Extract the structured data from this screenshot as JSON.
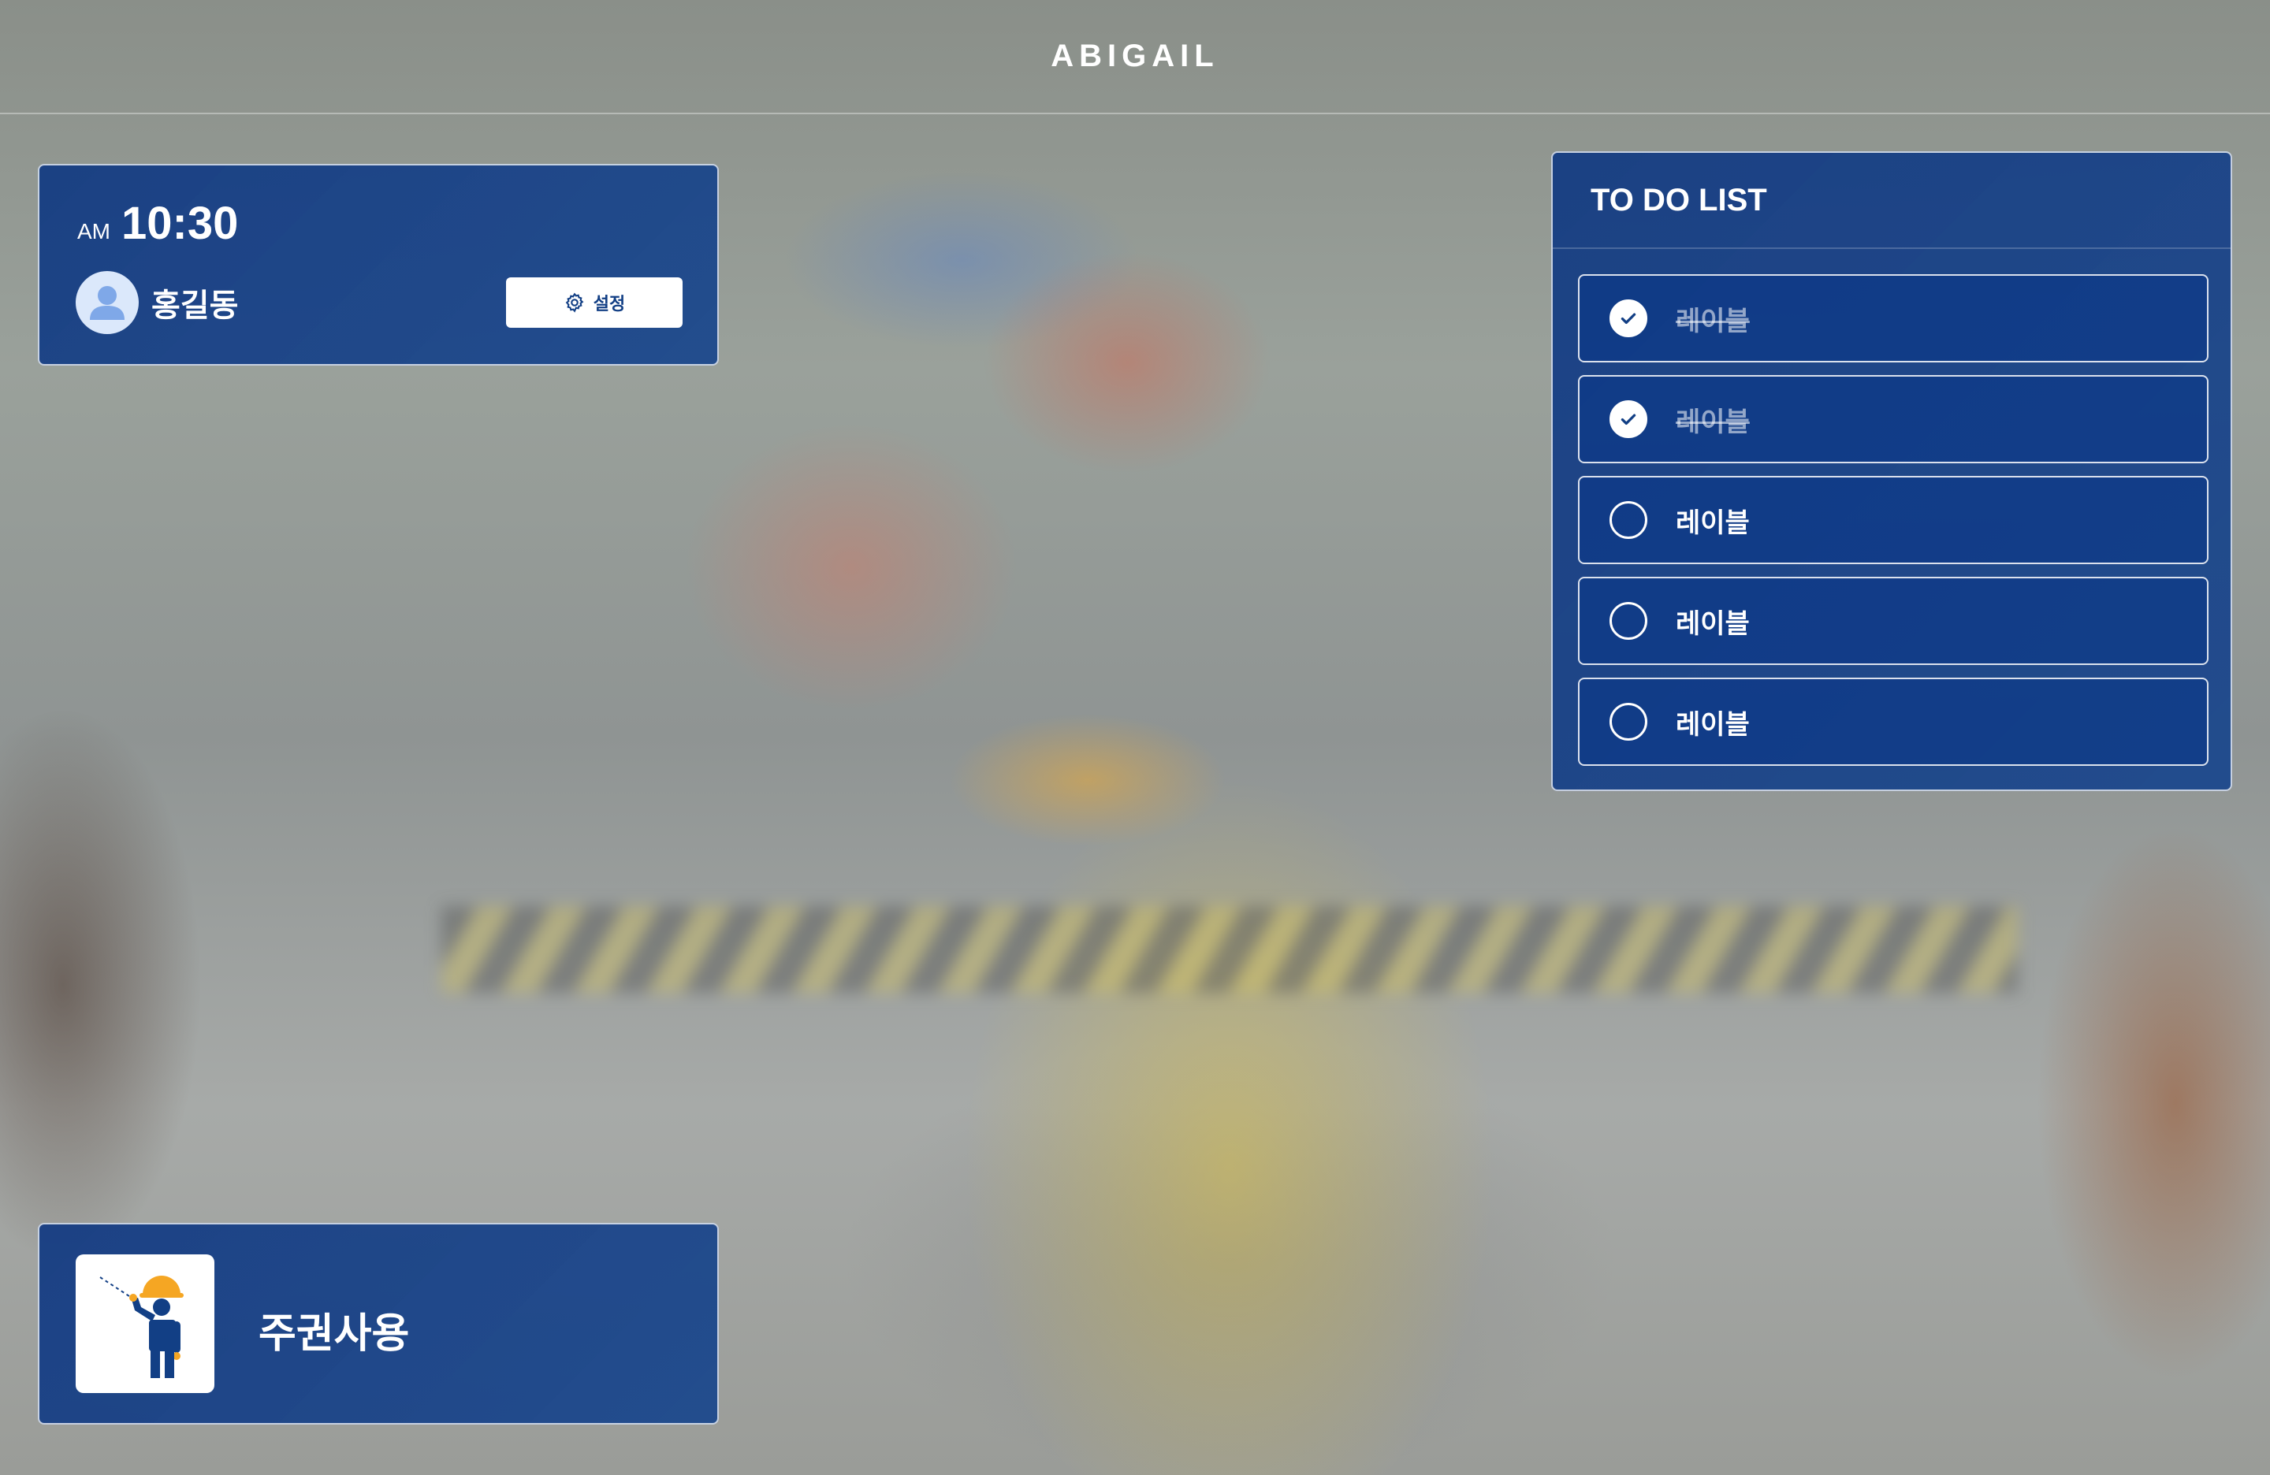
{
  "header": {
    "title": "ABIGAIL"
  },
  "profile": {
    "ampm": "AM",
    "time": "10:30",
    "user_name": "홍길동",
    "settings_label": "설정"
  },
  "todo": {
    "title": "TO DO LIST",
    "items": [
      {
        "label": "레이블",
        "done": true
      },
      {
        "label": "레이블",
        "done": true
      },
      {
        "label": "레이블",
        "done": false
      },
      {
        "label": "레이블",
        "done": false
      },
      {
        "label": "레이블",
        "done": false
      }
    ]
  },
  "mode": {
    "label": "주권사용",
    "icon": "worker-signal-icon"
  },
  "colors": {
    "card_bg": "#123a82",
    "card_border": "#ffffff",
    "accent_orange": "#f5a623",
    "icon_navy": "#123f85"
  }
}
